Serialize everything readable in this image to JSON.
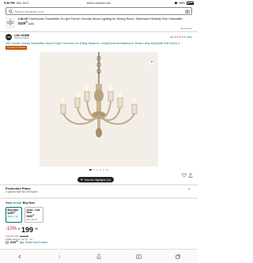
{
  "status_bar": {
    "time": "5:30 PM",
    "date": "Sun Jul 9",
    "url": "search.amazon.com",
    "battery": "89%"
  },
  "search": {
    "placeholder": "Search Amazon.com"
  },
  "sponsored_ad": {
    "title_prefix": "LALUZ",
    "title": " Farmhouse Chandelier, 6-Light French Country Wood Lighting for Dining Room, Distressed Shabby Chic Chandelie...",
    "price": "$229",
    "price_fraction": "99",
    "strike_price": "$269",
    "label": "Sponsored"
  },
  "brand": {
    "logo_text": "LNC",
    "name": "LNC HOME",
    "visit": "Visit the Store",
    "rating": "4.5",
    "stars": "★★★★★",
    "review_count": "(526)"
  },
  "product": {
    "title": "LNC French Country Chandeliers Wood 6 Light, Rod Arms for Dining, Bedroom, Living Room and Bathroom, Brown Lamp Body Bulb E26 5-AKO-1",
    "badge": "Amazon's Choice"
  },
  "carousel": {
    "dots": 6,
    "active_index": 0
  },
  "highlights": {
    "label": "View the Highlights (14)"
  },
  "protection": {
    "title": "Protection Plans",
    "subtitle": "3 options from $19.99/month"
  },
  "ways_to_buy": {
    "label": "Ways to buy: ",
    "selected": "Buy New",
    "options": [
      {
        "title": "Buy New",
        "price": "$199",
        "price_frac": "99",
        "date": "Jul 11 - 13"
      },
      {
        "title": "Used - Like New",
        "price": "$169",
        "price_frac": "99",
        "date": "Sat, Jul 15"
      }
    ]
  },
  "price": {
    "discount": "-10%",
    "symbol": "$",
    "whole": "199",
    "fraction": "99",
    "typical_label": "Typical price: ",
    "typical_value": "$219.99",
    "delivery": "FREE delivery Jul 11 - 13"
  },
  "prime_option": {
    "price": "$199",
    "price_frac": "99",
    "text": "(or) ",
    "link": "Select from 9 plans"
  },
  "colors": {
    "link": "#007185",
    "discount": "#cc0c39",
    "badge": "#c45500",
    "star": "#de7921"
  }
}
